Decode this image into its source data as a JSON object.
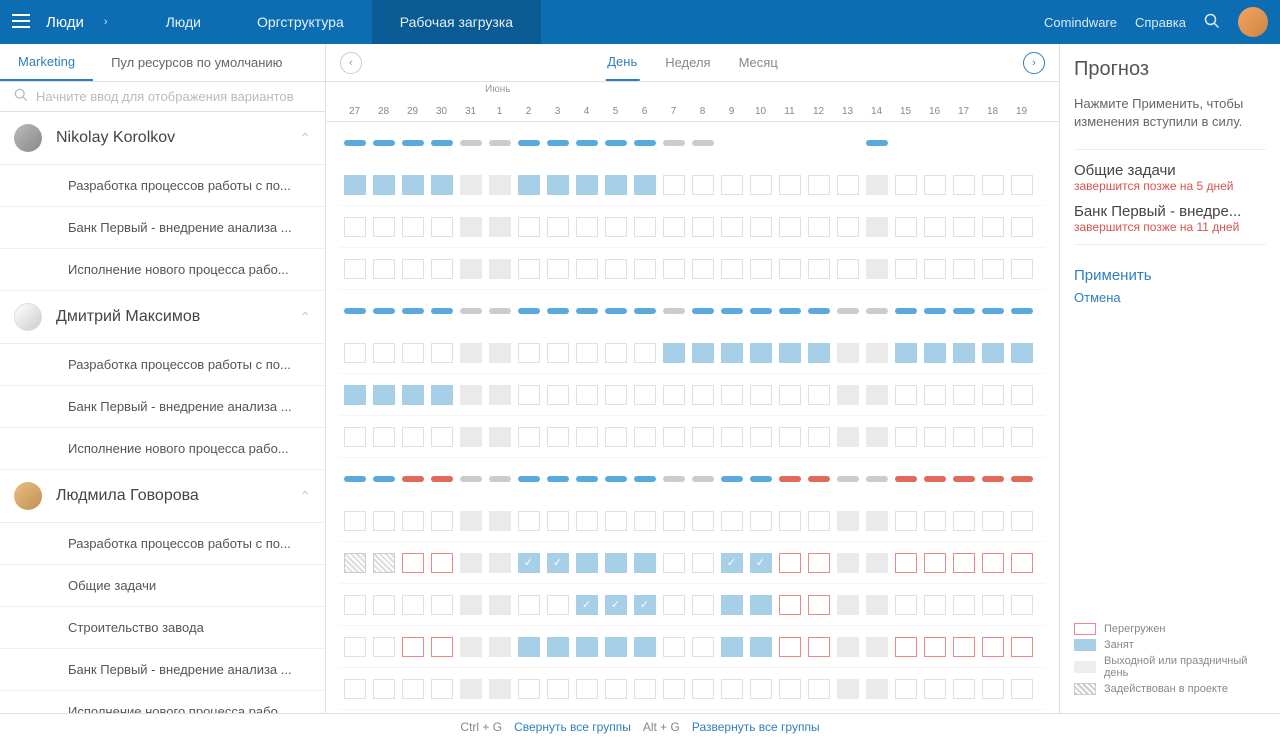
{
  "header": {
    "title": "Люди",
    "tabs": [
      "Люди",
      "Оргструктура",
      "Рабочая загрузка"
    ],
    "active_tab": 2,
    "brand": "Comindware",
    "help": "Справка"
  },
  "sidebar": {
    "tabs": [
      "Marketing",
      "Пул ресурсов по умолчанию"
    ],
    "active_tab": 0,
    "search_placeholder": "Начните ввод для отображения вариантов",
    "people": [
      {
        "name": "Nikolay Korolkov",
        "tasks": [
          "Разработка процессов работы с по...",
          "Банк Первый - внедрение анализа ...",
          "Исполнение нового процесса рабо..."
        ]
      },
      {
        "name": "Дмитрий Максимов",
        "tasks": [
          "Разработка процессов работы с по...",
          "Банк Первый - внедрение анализа ...",
          "Исполнение нового процесса рабо..."
        ]
      },
      {
        "name": "Людмила Говорова",
        "tasks": [
          "Разработка процессов работы с по...",
          "Общие задачи",
          "Строительство завода",
          "Банк Первый - внедрение анализа ...",
          "Исполнение нового процесса рабо..."
        ]
      }
    ]
  },
  "timeline": {
    "views": [
      "День",
      "Неделя",
      "Месяц"
    ],
    "active_view": 0,
    "month_label": "Июнь",
    "month_label_col": 5,
    "dates": [
      "27",
      "28",
      "29",
      "30",
      "31",
      "1",
      "2",
      "3",
      "4",
      "5",
      "6",
      "7",
      "8",
      "9",
      "10",
      "11",
      "12",
      "13",
      "14",
      "15",
      "16",
      "17",
      "18",
      "19"
    ],
    "rows": [
      {
        "type": "summary",
        "cells": [
          "b",
          "b",
          "b",
          "b",
          "g",
          "g",
          "b",
          "b",
          "b",
          "b",
          "b",
          "g",
          "g",
          "",
          "",
          "",
          "",
          "",
          "b",
          "",
          "",
          "",
          "",
          ""
        ]
      },
      {
        "type": "task",
        "cells": [
          "B",
          "B",
          "B",
          "B",
          "G",
          "G",
          "B",
          "B",
          "B",
          "B",
          "B",
          "E",
          "E",
          "E",
          "E",
          "E",
          "E",
          "E",
          "G",
          "E",
          "E",
          "E",
          "E",
          "E"
        ]
      },
      {
        "type": "task",
        "cells": [
          "E",
          "E",
          "E",
          "E",
          "G",
          "G",
          "E",
          "E",
          "E",
          "E",
          "E",
          "E",
          "E",
          "E",
          "E",
          "E",
          "E",
          "E",
          "G",
          "E",
          "E",
          "E",
          "E",
          "E"
        ]
      },
      {
        "type": "task",
        "cells": [
          "E",
          "E",
          "E",
          "E",
          "G",
          "G",
          "E",
          "E",
          "E",
          "E",
          "E",
          "E",
          "E",
          "E",
          "E",
          "E",
          "E",
          "E",
          "G",
          "E",
          "E",
          "E",
          "E",
          "E"
        ]
      },
      {
        "type": "summary",
        "cells": [
          "b",
          "b",
          "b",
          "b",
          "g",
          "g",
          "b",
          "b",
          "b",
          "b",
          "b",
          "g",
          "b",
          "b",
          "b",
          "b",
          "b",
          "g",
          "g",
          "b",
          "b",
          "b",
          "b",
          "b"
        ]
      },
      {
        "type": "task",
        "cells": [
          "E",
          "E",
          "E",
          "E",
          "G",
          "G",
          "E",
          "E",
          "E",
          "E",
          "E",
          "B",
          "B",
          "B",
          "B",
          "B",
          "B",
          "G",
          "G",
          "B",
          "B",
          "B",
          "B",
          "B"
        ]
      },
      {
        "type": "task",
        "cells": [
          "B",
          "B",
          "B",
          "B",
          "G",
          "G",
          "E",
          "E",
          "E",
          "E",
          "E",
          "E",
          "E",
          "E",
          "E",
          "E",
          "E",
          "G",
          "G",
          "E",
          "E",
          "E",
          "E",
          "E"
        ]
      },
      {
        "type": "task",
        "cells": [
          "E",
          "E",
          "E",
          "E",
          "G",
          "G",
          "E",
          "E",
          "E",
          "E",
          "E",
          "E",
          "E",
          "E",
          "E",
          "E",
          "E",
          "G",
          "G",
          "E",
          "E",
          "E",
          "E",
          "E"
        ]
      },
      {
        "type": "summary",
        "cells": [
          "b",
          "b",
          "r",
          "r",
          "g",
          "g",
          "b",
          "b",
          "b",
          "b",
          "b",
          "g",
          "g",
          "b",
          "b",
          "r",
          "r",
          "g",
          "g",
          "r",
          "r",
          "r",
          "r",
          "r"
        ]
      },
      {
        "type": "task",
        "cells": [
          "E",
          "E",
          "E",
          "E",
          "G",
          "G",
          "E",
          "E",
          "E",
          "E",
          "E",
          "E",
          "E",
          "E",
          "E",
          "E",
          "E",
          "G",
          "G",
          "E",
          "E",
          "E",
          "E",
          "E"
        ]
      },
      {
        "type": "task",
        "cells": [
          "H",
          "H",
          "R",
          "R",
          "G",
          "G",
          "C",
          "C",
          "B",
          "B",
          "B",
          "E",
          "E",
          "C",
          "C",
          "R",
          "R",
          "G",
          "G",
          "R",
          "R",
          "R",
          "R",
          "R"
        ]
      },
      {
        "type": "task",
        "cells": [
          "E",
          "E",
          "E",
          "E",
          "G",
          "G",
          "E",
          "E",
          "C",
          "C",
          "C",
          "E",
          "E",
          "B",
          "B",
          "R",
          "R",
          "G",
          "G",
          "E",
          "E",
          "E",
          "E",
          "E"
        ]
      },
      {
        "type": "task",
        "cells": [
          "E",
          "E",
          "R",
          "R",
          "G",
          "G",
          "B",
          "B",
          "B",
          "B",
          "B",
          "E",
          "E",
          "B",
          "B",
          "R",
          "R",
          "G",
          "G",
          "R",
          "R",
          "R",
          "R",
          "R"
        ]
      },
      {
        "type": "task",
        "cells": [
          "E",
          "E",
          "E",
          "E",
          "G",
          "G",
          "E",
          "E",
          "E",
          "E",
          "E",
          "E",
          "E",
          "E",
          "E",
          "E",
          "E",
          "G",
          "G",
          "E",
          "E",
          "E",
          "E",
          "E"
        ]
      }
    ]
  },
  "forecast": {
    "title": "Прогноз",
    "hint": "Нажмите Применить, чтобы изменения вступили в силу.",
    "items": [
      {
        "title": "Общие задачи",
        "sub": "завершится позже на 5 дней"
      },
      {
        "title": "Банк Первый - внедре...",
        "sub": "завершится позже на 11 дней"
      }
    ],
    "apply": "Применить",
    "cancel": "Отмена"
  },
  "legend": {
    "items": [
      {
        "cls": "red",
        "label": "Перегружен"
      },
      {
        "cls": "blue",
        "label": "Занят"
      },
      {
        "cls": "gray",
        "label": "Выходной или праздничный",
        "label2": "день"
      },
      {
        "cls": "hatch",
        "label": "Задействован в проекте"
      }
    ]
  },
  "footer": {
    "k1": "Ctrl + G",
    "l1": "Свернуть все группы",
    "k2": "Alt + G",
    "l2": "Развернуть все группы"
  }
}
